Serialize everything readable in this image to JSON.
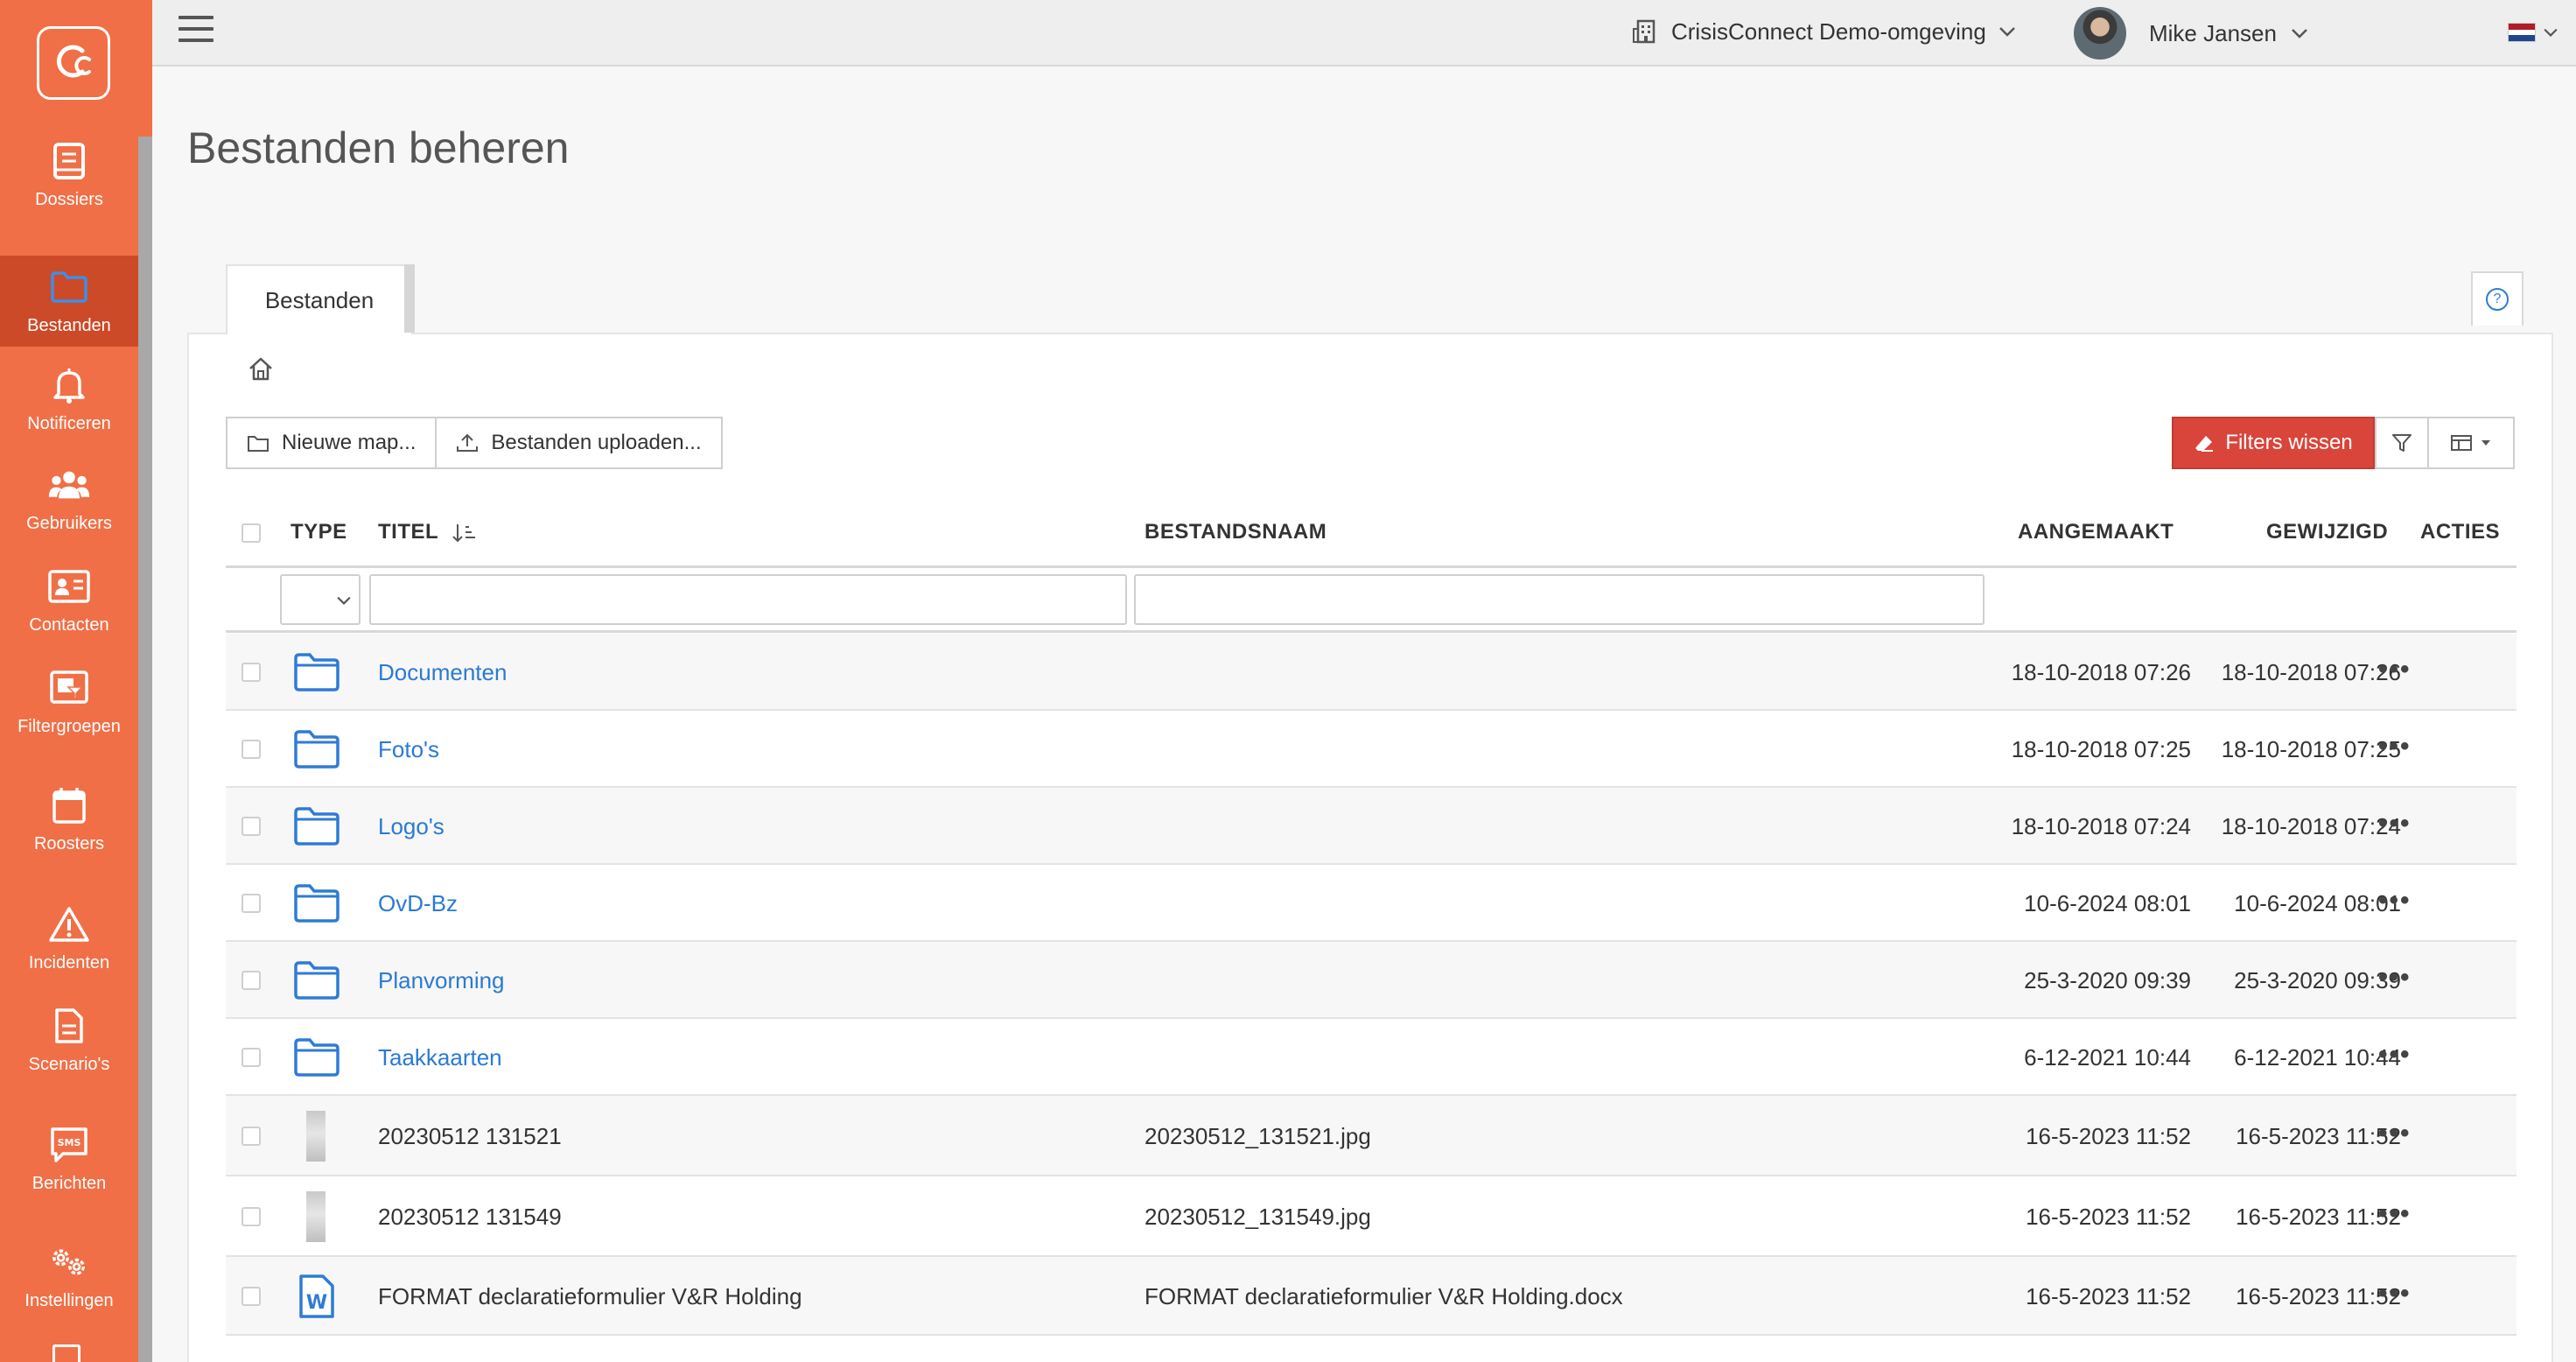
{
  "sidebar": {
    "items": [
      {
        "label": "Dossiers",
        "icon": "book-icon"
      },
      {
        "label": "Bestanden",
        "icon": "folder-icon",
        "active": true
      },
      {
        "label": "Notificeren",
        "icon": "bell-icon"
      },
      {
        "label": "Gebruikers",
        "icon": "users-icon"
      },
      {
        "label": "Contacten",
        "icon": "contact-card-icon"
      },
      {
        "label": "Filtergroepen",
        "icon": "filter-group-icon"
      },
      {
        "label": "Roosters",
        "icon": "calendar-icon"
      },
      {
        "label": "Incidenten",
        "icon": "warning-icon"
      },
      {
        "label": "Scenario's",
        "icon": "document-icon"
      },
      {
        "label": "Berichten",
        "icon": "sms-icon"
      },
      {
        "label": "Instellingen",
        "icon": "gears-icon"
      }
    ],
    "accent": "#f06f47",
    "active_bg": "#cc4a27"
  },
  "topbar": {
    "environment": "CrisisConnect Demo-omgeving",
    "user_name": "Mike Jansen",
    "language": "nl"
  },
  "page": {
    "title": "Bestanden beheren",
    "tab_label": "Bestanden"
  },
  "toolbar": {
    "new_folder_label": "Nieuwe map...",
    "upload_label": "Bestanden uploaden...",
    "clear_filters_label": "Filters wissen",
    "danger_color": "#d9453b"
  },
  "table": {
    "headers": {
      "type": "TYPE",
      "title": "TITEL",
      "filename": "BESTANDSNAAM",
      "created": "AANGEMAAKT",
      "modified": "GEWIJZIGD",
      "actions": "ACTIES"
    },
    "rows": [
      {
        "type": "folder",
        "title": "Documenten",
        "filename": "",
        "created": "18-10-2018 07:26",
        "modified": "18-10-2018 07:26"
      },
      {
        "type": "folder",
        "title": "Foto's",
        "filename": "",
        "created": "18-10-2018 07:25",
        "modified": "18-10-2018 07:25"
      },
      {
        "type": "folder",
        "title": "Logo's",
        "filename": "",
        "created": "18-10-2018 07:24",
        "modified": "18-10-2018 07:24"
      },
      {
        "type": "folder",
        "title": "OvD-Bz",
        "filename": "",
        "created": "10-6-2024 08:01",
        "modified": "10-6-2024 08:01"
      },
      {
        "type": "folder",
        "title": "Planvorming",
        "filename": "",
        "created": "25-3-2020 09:39",
        "modified": "25-3-2020 09:39"
      },
      {
        "type": "folder",
        "title": "Taakkaarten",
        "filename": "",
        "created": "6-12-2021 10:44",
        "modified": "6-12-2021 10:44"
      },
      {
        "type": "image",
        "title": "20230512 131521",
        "filename": "20230512_131521.jpg",
        "created": "16-5-2023 11:52",
        "modified": "16-5-2023 11:52"
      },
      {
        "type": "image",
        "title": "20230512 131549",
        "filename": "20230512_131549.jpg",
        "created": "16-5-2023 11:52",
        "modified": "16-5-2023 11:52"
      },
      {
        "type": "word",
        "title": "FORMAT declaratieformulier V&R Holding",
        "filename": "FORMAT declaratieformulier V&R Holding.docx",
        "created": "16-5-2023 11:52",
        "modified": "16-5-2023 11:52"
      }
    ],
    "actions_glyph": "•••"
  }
}
